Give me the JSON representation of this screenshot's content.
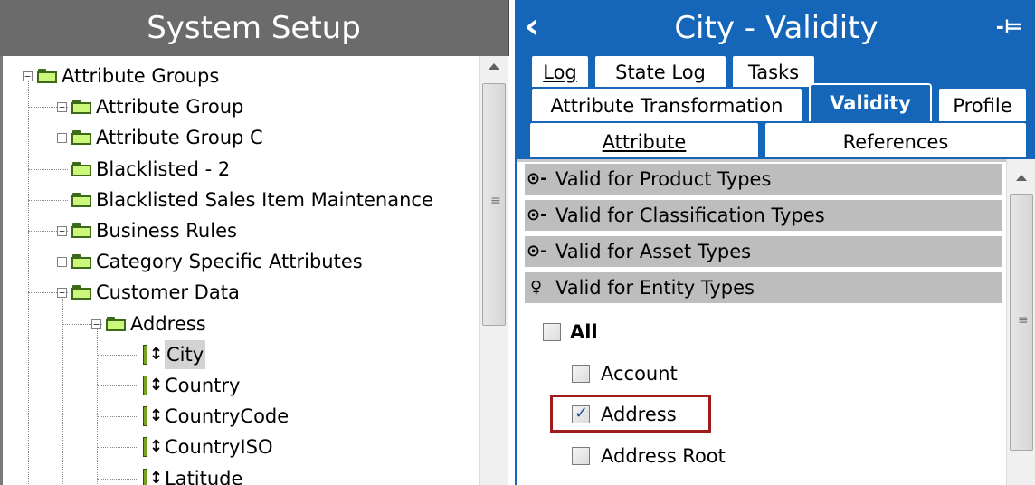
{
  "left": {
    "title": "System Setup",
    "tree": [
      {
        "label": "Attribute Groups",
        "depth": 0,
        "type": "folder",
        "expander": "minus"
      },
      {
        "label": "Attribute Group",
        "depth": 1,
        "type": "folder",
        "expander": "plus"
      },
      {
        "label": "Attribute Group C",
        "depth": 1,
        "type": "folder",
        "expander": "plus"
      },
      {
        "label": "Blacklisted - 2",
        "depth": 1,
        "type": "folder",
        "expander": "none"
      },
      {
        "label": "Blacklisted Sales Item Maintenance",
        "depth": 1,
        "type": "folder",
        "expander": "none"
      },
      {
        "label": "Business Rules",
        "depth": 1,
        "type": "folder",
        "expander": "plus"
      },
      {
        "label": "Category Specific Attributes",
        "depth": 1,
        "type": "folder",
        "expander": "plus"
      },
      {
        "label": "Customer Data",
        "depth": 1,
        "type": "folder",
        "expander": "minus"
      },
      {
        "label": "Address",
        "depth": 2,
        "type": "folder",
        "expander": "minus"
      },
      {
        "label": "City",
        "depth": 3,
        "type": "attribute",
        "expander": "none",
        "selected": true
      },
      {
        "label": "Country",
        "depth": 3,
        "type": "attribute",
        "expander": "none"
      },
      {
        "label": "CountryCode",
        "depth": 3,
        "type": "attribute",
        "expander": "none"
      },
      {
        "label": "CountryISO",
        "depth": 3,
        "type": "attribute",
        "expander": "none"
      },
      {
        "label": "Latitude",
        "depth": 3,
        "type": "attribute",
        "expander": "none"
      }
    ]
  },
  "right": {
    "back_icon": "‹",
    "title": "City - Validity",
    "pin_icon": "-⊨",
    "tabs_row1": [
      "Log",
      "State Log",
      "Tasks"
    ],
    "tabs_row2": [
      "Attribute Transformation",
      "Validity",
      "Profile"
    ],
    "tabs_row3": [
      "Attribute",
      "References"
    ],
    "active_tab": "Validity",
    "sections": [
      {
        "label": "Valid for Product Types",
        "icon": "collapsed"
      },
      {
        "label": "Valid for Classification Types",
        "icon": "collapsed"
      },
      {
        "label": "Valid for Asset Types",
        "icon": "collapsed"
      },
      {
        "label": "Valid for Entity Types",
        "icon": "expanded"
      }
    ],
    "all_label": "All",
    "options": [
      {
        "label": "Account",
        "checked": false
      },
      {
        "label": "Address",
        "checked": true
      },
      {
        "label": "Address Root",
        "checked": false
      }
    ]
  },
  "colors": {
    "accent_blue": "#1565b8",
    "header_gray": "#6b6b6b",
    "section_gray": "#bdbdbd",
    "highlight_red": "#9e1b1b",
    "folder_green": "#ccf77a"
  }
}
